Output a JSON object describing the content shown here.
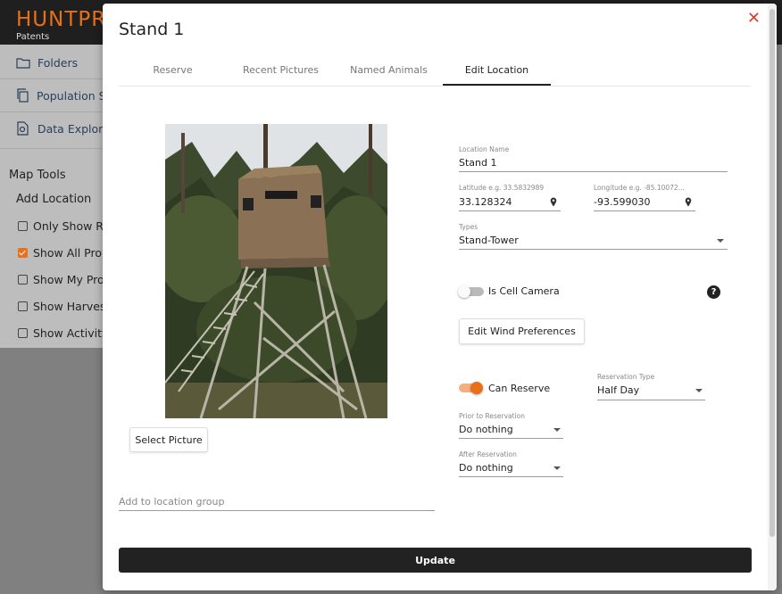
{
  "app": {
    "logo_text": "HUNTPR",
    "logo_sub": "Patents"
  },
  "sidebar": {
    "items": [
      {
        "label": "Folders",
        "icon": "folder-icon"
      },
      {
        "label": "Population St",
        "icon": "copy-icon"
      },
      {
        "label": "Data Explore",
        "icon": "data-explorer-icon"
      }
    ],
    "map_tools_title": "Map Tools",
    "add_location": "Add Location",
    "checkboxes": [
      {
        "label": "Only Show Re",
        "checked": false
      },
      {
        "label": "Show All Prop",
        "checked": true
      },
      {
        "label": "Show My Prop",
        "checked": false
      },
      {
        "label": "Show Harves",
        "checked": false
      },
      {
        "label": "Show Activity",
        "checked": false
      }
    ]
  },
  "modal": {
    "title": "Stand 1",
    "close_glyph": "✕",
    "tabs": [
      "Reserve",
      "Recent Pictures",
      "Named Animals",
      "Edit Location"
    ],
    "active_tab": "Edit Location",
    "select_picture": "Select Picture",
    "location_name": {
      "label": "Location Name",
      "value": "Stand 1"
    },
    "latitude": {
      "label": "Latitude e.g. 33.5832989",
      "value": "33.128324"
    },
    "longitude": {
      "label": "Longitude e.g. -85.10072...",
      "value": "-93.599030"
    },
    "types": {
      "label": "Types",
      "value": "Stand-Tower"
    },
    "cell_camera": {
      "label": "Is Cell Camera",
      "on": false
    },
    "help_glyph": "?",
    "edit_wind": "Edit Wind Preferences",
    "can_reserve": {
      "label": "Can Reserve",
      "on": true
    },
    "reservation_type": {
      "label": "Reservation Type",
      "value": "Half Day"
    },
    "prior_reservation": {
      "label": "Prior to Reservation",
      "value": "Do nothing"
    },
    "after_reservation": {
      "label": "After Reservation",
      "value": "Do nothing"
    },
    "location_group_placeholder": "Add to location group",
    "update": "Update"
  },
  "colors": {
    "accent": "#e8701a",
    "close": "#e03a2f",
    "dark_button": "#222222"
  }
}
